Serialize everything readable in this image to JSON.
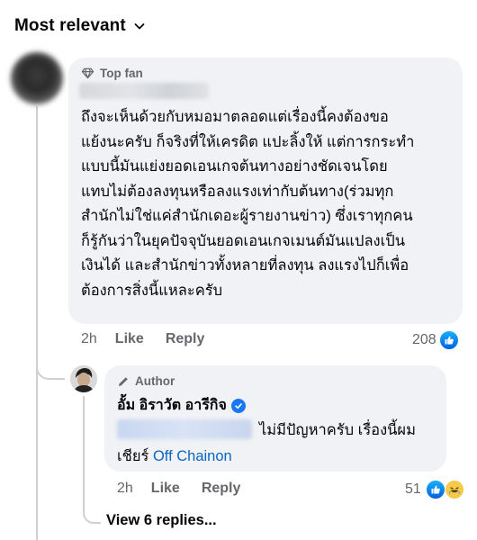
{
  "sort": {
    "label": "Most relevant"
  },
  "comment": {
    "badge": "Top fan",
    "text": "ถึงจะเห็นด้วยกับหมอมาตลอดแต่เรื่องนี้คงต้องขอ\nแย้งนะครับ ก็จริงที่ให้เครดิต แปะลิ้งให้ แต่การกระทำ\nแบบนี้มันแย่งยอดเอนเกจต้นทางอย่างชัดเจนโดย\nแทบไม่ต้องลงทุนหรือลงแรงเท่ากับต้นทาง(ร่วมทุก\nสำนักไม่ใช่แค่สำนักเดอะผู้รายงานข่าว) ซึ่งเราทุกคน\nก็รู้กันว่าในยุคปัจจุบันยอดเอนเกจเมนต์มันแปลงเป็น\nเงินได้ และสำนักข่าวทั้งหลายที่ลงทุน ลงแรงไปก็เพื่อ\nต้องการสิ่งนี้แหละครับ",
    "time": "2h",
    "like_label": "Like",
    "reply_label": "Reply",
    "reaction_count": "208"
  },
  "reply": {
    "author_badge": "Author",
    "name": "อั้ม อิราวัต อารีกิจ",
    "text_line1": "ไม่มีปัญหาครับ เรื่องนี้ผม",
    "text_line2_prefix": "เชียร์ ",
    "mention": "Off Chainon",
    "time": "2h",
    "like_label": "Like",
    "reply_label": "Reply",
    "reaction_count": "51"
  },
  "view_replies": "View 6 replies...",
  "colors": {
    "accent": "#1877f2",
    "link": "#0a66c2",
    "bubble": "#f0f2f5",
    "muted": "#65676b"
  }
}
